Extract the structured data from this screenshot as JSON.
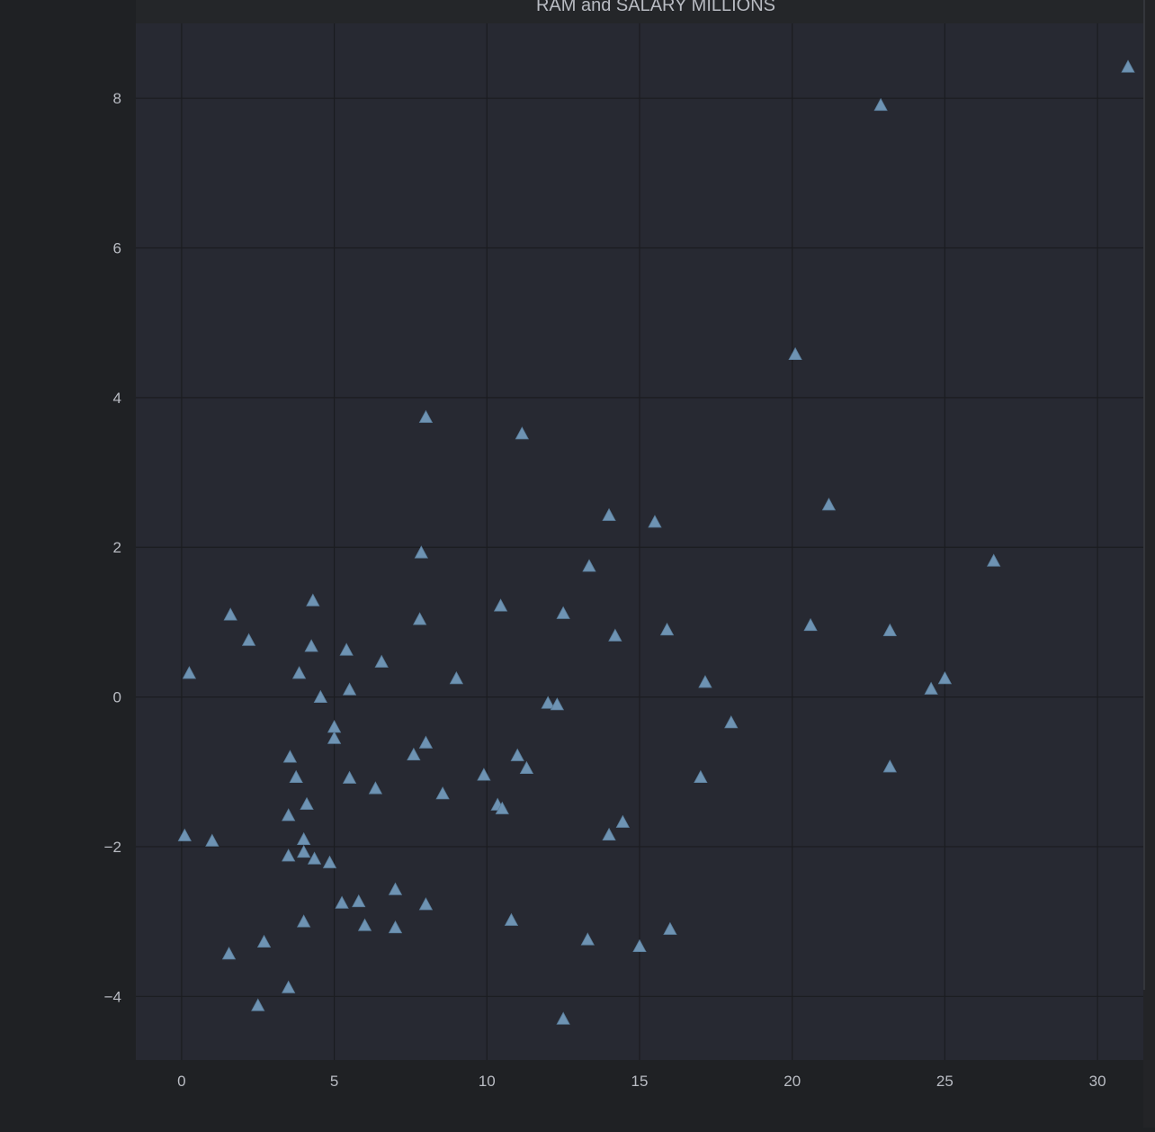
{
  "chart_data": {
    "type": "scatter",
    "title": "RAM and SALARY MILLIONS",
    "xlabel": "",
    "ylabel": "",
    "xlim": [
      -1.5,
      31.5
    ],
    "ylim": [
      -4.85,
      9.0
    ],
    "x_ticks": [
      0,
      5,
      10,
      15,
      20,
      25,
      30
    ],
    "y_ticks": [
      -4,
      -2,
      0,
      2,
      4,
      6,
      8
    ],
    "x_tick_labels": [
      "0",
      "5",
      "10",
      "15",
      "20",
      "25",
      "30"
    ],
    "y_tick_labels": [
      "−4",
      "−2",
      "0",
      "2",
      "4",
      "6",
      "8"
    ],
    "grid": true,
    "marker": "triangle",
    "colors": {
      "page_background": "#1f2124",
      "plot_background": "#272932",
      "grid": "#1b1c20",
      "marker": "#6e93b3",
      "tick_text": "#b9bcc3",
      "title_text": "#b9bcc3"
    },
    "series": [
      {
        "points": [
          [
            0.1,
            -1.85
          ],
          [
            1.0,
            -1.92
          ],
          [
            0.25,
            0.32
          ],
          [
            1.6,
            1.1
          ],
          [
            2.2,
            0.76
          ],
          [
            1.55,
            -3.43
          ],
          [
            2.5,
            -4.12
          ],
          [
            2.7,
            -3.27
          ],
          [
            3.5,
            -3.88
          ],
          [
            3.5,
            -1.58
          ],
          [
            3.5,
            -2.12
          ],
          [
            3.55,
            -0.8
          ],
          [
            3.75,
            -1.07
          ],
          [
            3.85,
            0.32
          ],
          [
            4.0,
            -1.9
          ],
          [
            4.0,
            -2.07
          ],
          [
            4.0,
            -3.0
          ],
          [
            4.1,
            -1.43
          ],
          [
            4.25,
            0.68
          ],
          [
            4.3,
            1.29
          ],
          [
            4.35,
            -2.16
          ],
          [
            4.55,
            0.0
          ],
          [
            4.85,
            -2.21
          ],
          [
            5.0,
            -0.4
          ],
          [
            5.0,
            -0.55
          ],
          [
            5.25,
            -2.75
          ],
          [
            5.4,
            0.63
          ],
          [
            5.5,
            0.1
          ],
          [
            5.5,
            -1.08
          ],
          [
            5.8,
            -2.73
          ],
          [
            6.0,
            -3.05
          ],
          [
            6.35,
            -1.22
          ],
          [
            6.55,
            0.47
          ],
          [
            7.0,
            -2.57
          ],
          [
            7.0,
            -3.08
          ],
          [
            7.6,
            -0.77
          ],
          [
            7.8,
            1.04
          ],
          [
            7.85,
            1.93
          ],
          [
            8.0,
            3.74
          ],
          [
            8.0,
            -0.61
          ],
          [
            8.0,
            -2.77
          ],
          [
            8.55,
            -1.29
          ],
          [
            9.0,
            0.25
          ],
          [
            9.9,
            -1.04
          ],
          [
            10.35,
            -1.44
          ],
          [
            10.5,
            -1.49
          ],
          [
            10.45,
            1.22
          ],
          [
            10.8,
            -2.98
          ],
          [
            11.0,
            -0.78
          ],
          [
            11.15,
            3.52
          ],
          [
            11.3,
            -0.95
          ],
          [
            12.0,
            -0.08
          ],
          [
            12.3,
            -0.1
          ],
          [
            12.5,
            1.12
          ],
          [
            12.5,
            -4.3
          ],
          [
            13.3,
            -3.24
          ],
          [
            13.35,
            1.75
          ],
          [
            14.0,
            2.43
          ],
          [
            14.0,
            -1.84
          ],
          [
            14.2,
            0.82
          ],
          [
            14.45,
            -1.67
          ],
          [
            15.0,
            -3.33
          ],
          [
            15.5,
            2.34
          ],
          [
            15.9,
            0.9
          ],
          [
            16.0,
            -3.1
          ],
          [
            17.0,
            -1.07
          ],
          [
            17.15,
            0.2
          ],
          [
            18.0,
            -0.34
          ],
          [
            20.1,
            4.58
          ],
          [
            20.6,
            0.96
          ],
          [
            21.2,
            2.57
          ],
          [
            22.9,
            7.91
          ],
          [
            23.2,
            0.89
          ],
          [
            23.2,
            -0.93
          ],
          [
            24.55,
            0.11
          ],
          [
            25.0,
            0.25
          ],
          [
            26.6,
            1.82
          ],
          [
            31.0,
            8.42
          ]
        ]
      }
    ]
  }
}
